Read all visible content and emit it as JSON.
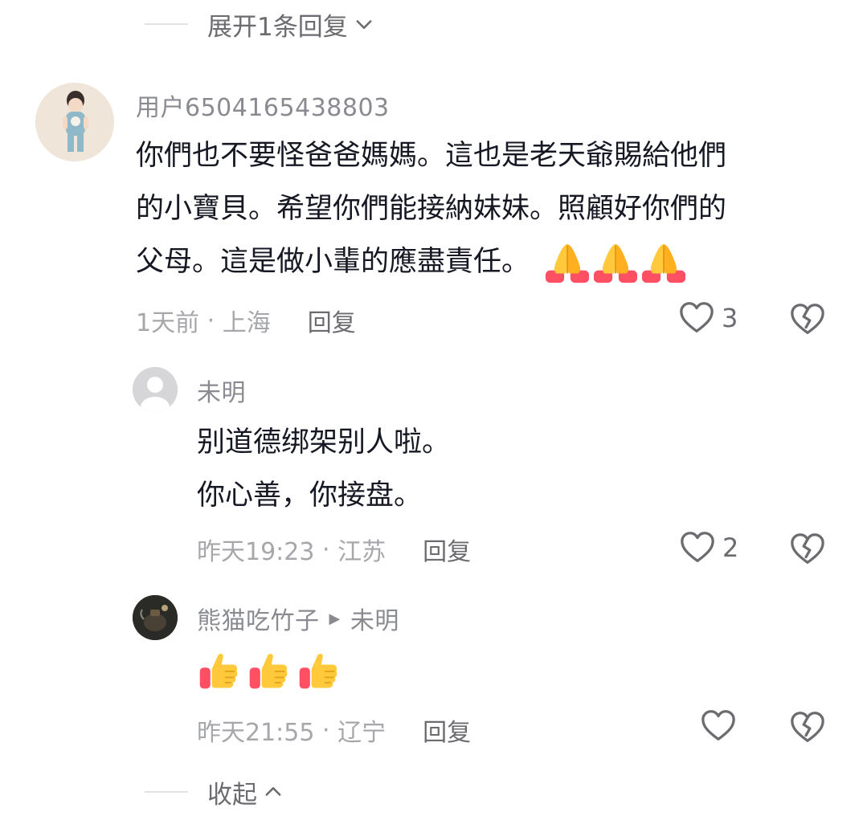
{
  "thread": {
    "expand_label": "展开1条回复",
    "collapse_label": "收起"
  },
  "comments": [
    {
      "username": "用户6504165438803",
      "lines": [
        "你們也不要怪爸爸媽媽。這也是老天爺賜給他們",
        "的小寶貝。希望你們能接納妹妹。照顧好你們的",
        "父母。這是做小輩的應盡責任。"
      ],
      "emojis": [
        "folded-hands",
        "folded-hands",
        "folded-hands"
      ],
      "time": "1天前",
      "location": "上海",
      "reply_label": "回复",
      "likes": "3"
    },
    {
      "username": "未明",
      "lines": [
        "别道德绑架别人啦。",
        "你心善，你接盘。"
      ],
      "time": "昨天19:23",
      "location": "江苏",
      "reply_label": "回复",
      "likes": "2"
    },
    {
      "username": "熊猫吃竹子",
      "reply_to": "未明",
      "emojis": [
        "thumbs-up",
        "thumbs-up",
        "thumbs-up"
      ],
      "time": "昨天21:55",
      "location": "辽宁",
      "reply_label": "回复",
      "likes": ""
    }
  ],
  "colors": {
    "text": "#161823",
    "secondary": "#8a8b91",
    "meta": "#a6a7ab"
  }
}
